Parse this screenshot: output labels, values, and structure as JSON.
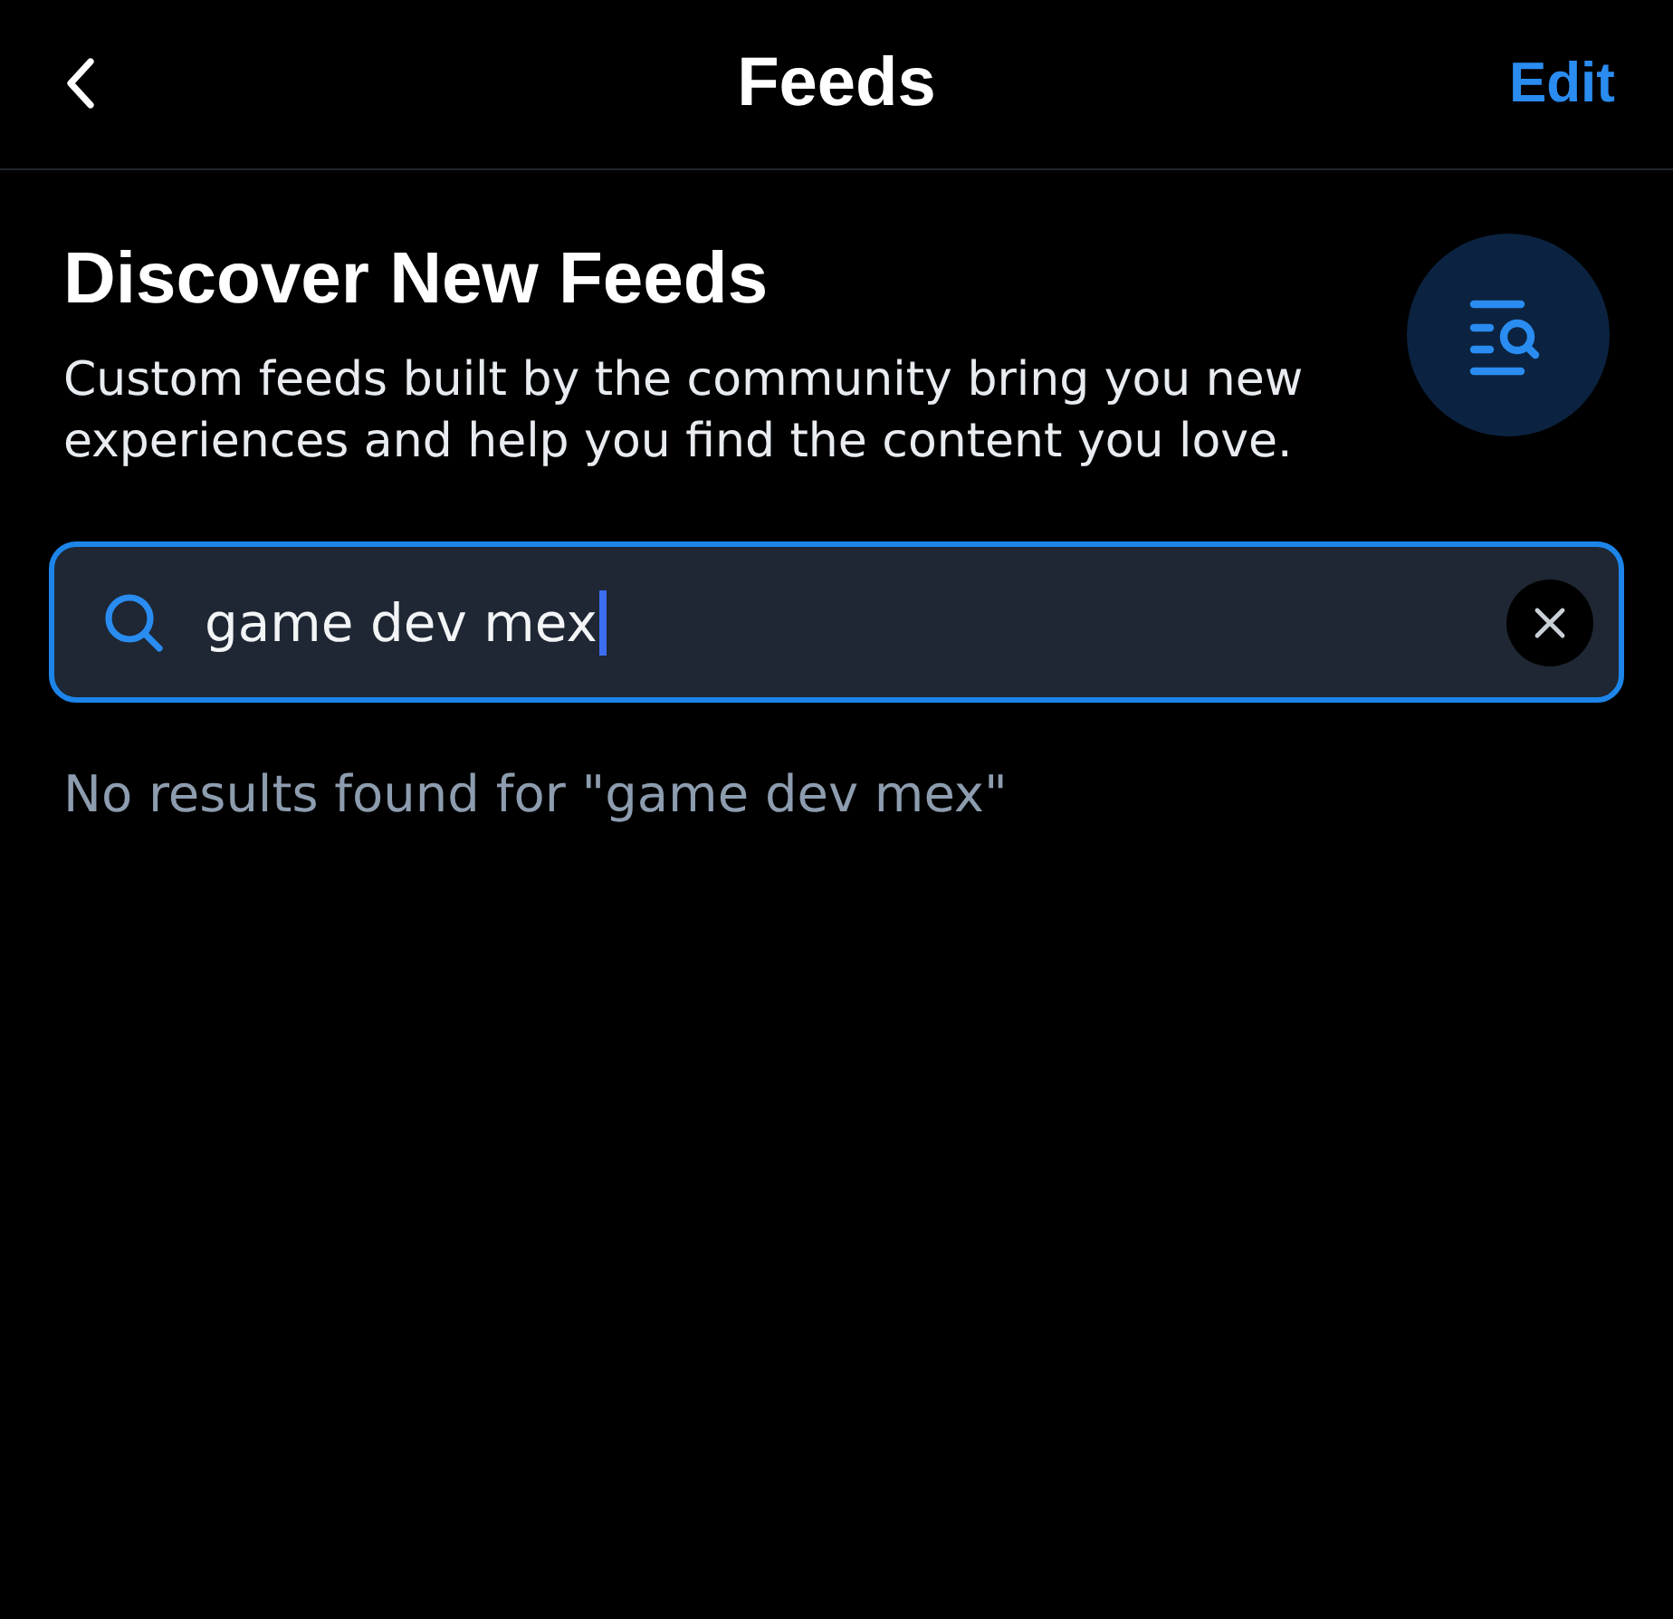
{
  "header": {
    "title": "Feeds",
    "edit_label": "Edit"
  },
  "discover": {
    "title": "Discover New Feeds",
    "description": "Custom feeds built by the community bring you new experiences and help you find the content you love."
  },
  "search": {
    "value": "game dev mex",
    "focused": true
  },
  "empty_message": "No results found for \"game dev mex\""
}
